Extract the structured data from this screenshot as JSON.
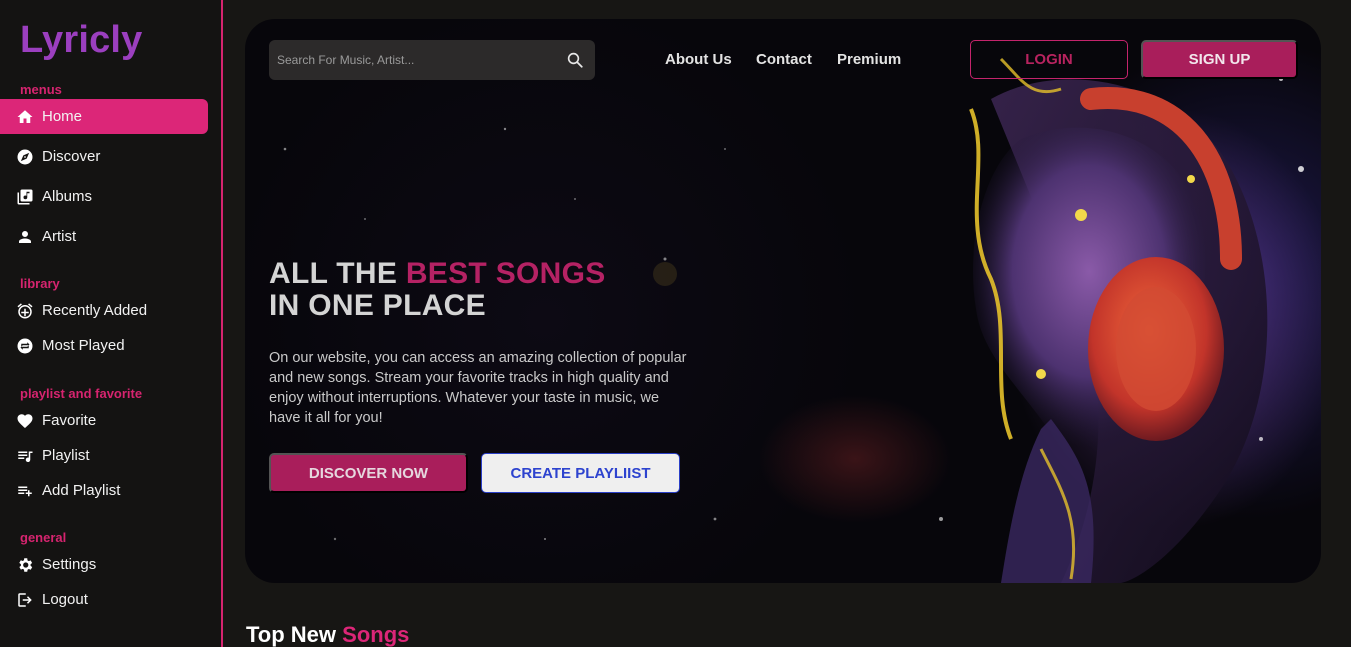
{
  "app": {
    "logo": "Lyricly"
  },
  "sidebar": {
    "sections": {
      "menus": "menus",
      "library": "library",
      "playlist": "playlist and favorite",
      "general": "general"
    },
    "items": {
      "home": "Home",
      "discover": "Discover",
      "albums": "Albums",
      "artist": "Artist",
      "recently_added": "Recently Added",
      "most_played": "Most Played",
      "favorite": "Favorite",
      "playlist": "Playlist",
      "add_playlist": "Add Playlist",
      "settings": "Settings",
      "logout": "Logout"
    },
    "active_item": "Home"
  },
  "header": {
    "search_placeholder": "Search For Music, Artist...",
    "links": {
      "about": "About Us",
      "contact": "Contact",
      "premium": "Premium"
    },
    "login_label": "LOGIN",
    "signup_label": "SIGN UP"
  },
  "hero": {
    "headline_part1": "ALL THE ",
    "headline_accent": "BEST SONGS",
    "headline_line2": "IN ONE PLACE",
    "description": "On our website, you can access an amazing collection of popular and new songs. Stream your favorite tracks in high quality and enjoy without interruptions. Whatever your taste in music, we have it all for you!",
    "discover_label": "DISCOVER NOW",
    "create_label": "CREATE PLAYLIIST"
  },
  "section": {
    "title_part1": "Top New ",
    "title_accent": "Songs"
  },
  "colors": {
    "accent": "#dc2678",
    "brand": "#9b3fbf",
    "secondary": "#2d43cf"
  }
}
